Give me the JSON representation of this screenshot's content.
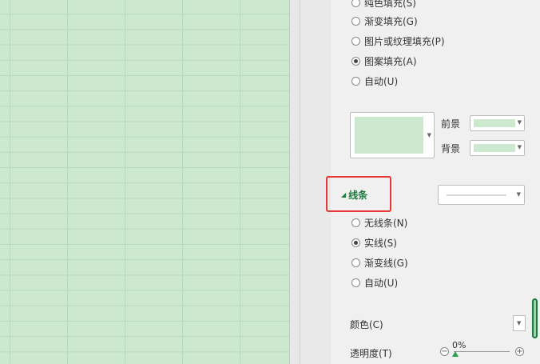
{
  "fill_options": [
    {
      "label": "纯色填充(S)",
      "checked": false
    },
    {
      "label": "渐变填充(G)",
      "checked": false
    },
    {
      "label": "图片或纹理填充(P)",
      "checked": false
    },
    {
      "label": "图案填充(A)",
      "checked": true
    },
    {
      "label": "自动(U)",
      "checked": false
    }
  ],
  "pattern": {
    "foreground_label": "前景",
    "background_label": "背景",
    "pattern_color": "#cce8cf",
    "foreground_color": "#cce8cf",
    "background_color": "#cce8cf"
  },
  "line_section": {
    "title": "线条",
    "options": [
      {
        "label": "无线条(N)",
        "checked": false
      },
      {
        "label": "实线(S)",
        "checked": true
      },
      {
        "label": "渐变线(G)",
        "checked": false
      },
      {
        "label": "自动(U)",
        "checked": false
      }
    ],
    "color_label": "颜色(C)",
    "transparency_label": "透明度(T)",
    "transparency_value": "0%",
    "transparency_fraction": 0
  },
  "colors": {
    "sheet_background": "#cce8cf",
    "accent_green": "#1e7a3e",
    "highlight_red": "#e53935"
  }
}
